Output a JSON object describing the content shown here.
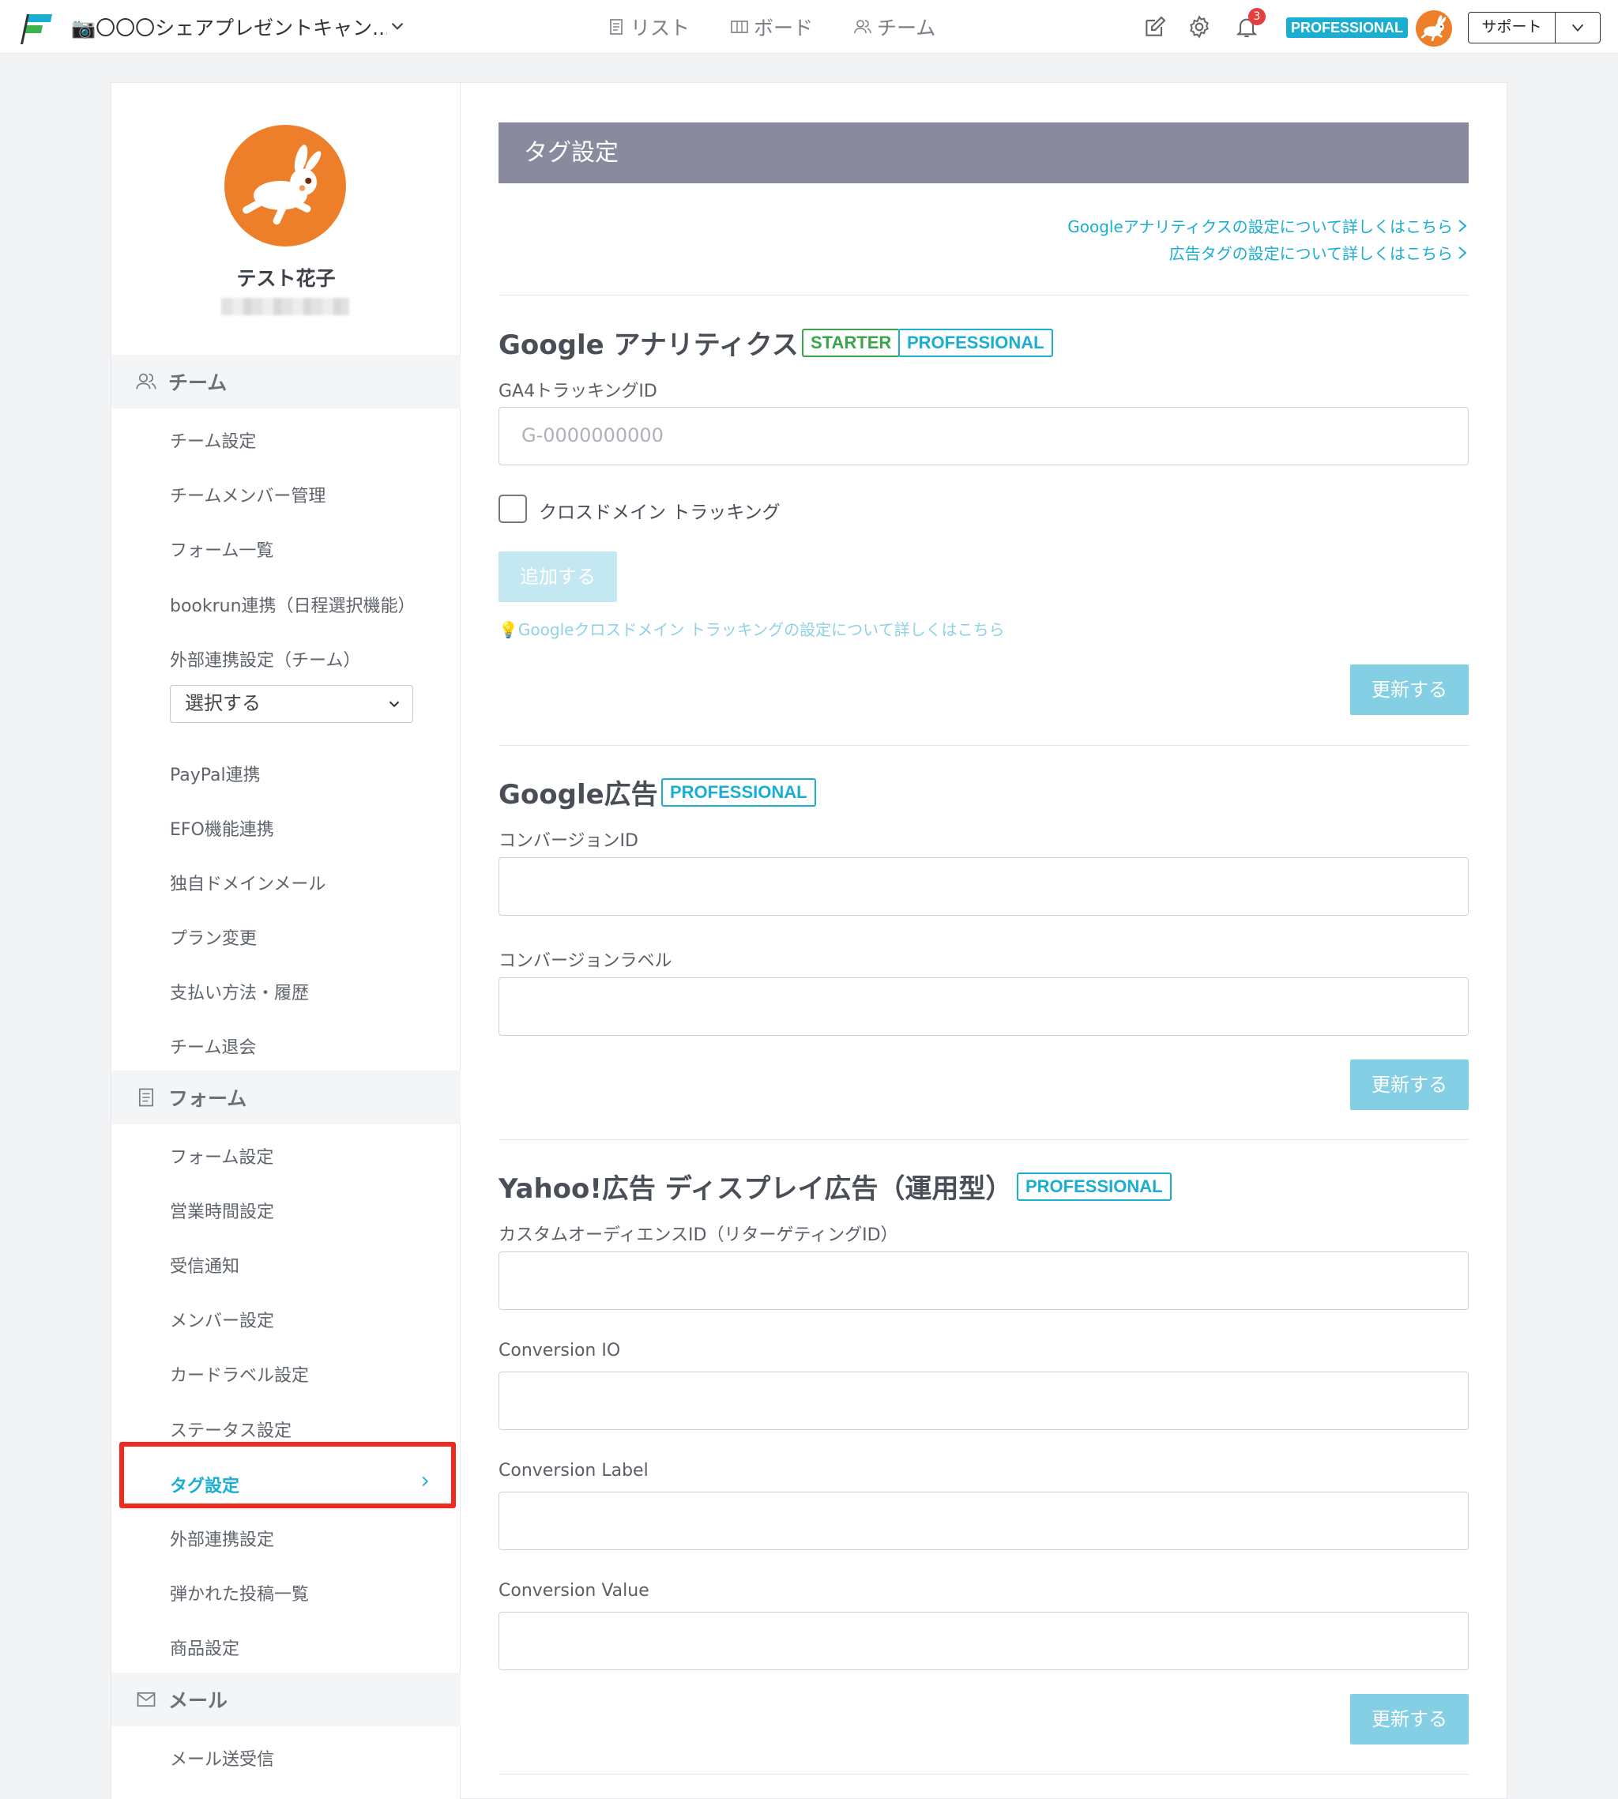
{
  "header": {
    "project_title": "📷〇〇〇シェアプレゼントキャン...",
    "nav": [
      {
        "label": "リスト",
        "icon": "list-doc-icon"
      },
      {
        "label": "ボード",
        "icon": "board-columns-icon"
      },
      {
        "label": "チーム",
        "icon": "team-people-icon"
      }
    ],
    "notification_count": "3",
    "plan_badge": "PROFESSIONAL",
    "support_label": "サポート",
    "accent_color": "#1aaed1"
  },
  "sidebar": {
    "user_name": "テスト花子",
    "sections": [
      {
        "title": "チーム",
        "icon": "team-people-icon",
        "items": [
          "チーム設定",
          "チームメンバー管理",
          "フォーム一覧",
          "bookrun連携（日程選択機能）",
          "外部連携設定（チーム）"
        ]
      },
      {
        "title": "フォーム",
        "icon": "form-doc-icon",
        "items": [
          "フォーム設定",
          "営業時間設定",
          "受信通知",
          "メンバー設定",
          "カードラベル設定",
          "ステータス設定",
          "タグ設定",
          "外部連携設定",
          "弾かれた投稿一覧",
          "商品設定"
        ]
      },
      {
        "title": "メール",
        "icon": "mail-envelope-icon",
        "items": [
          "メール送受信"
        ]
      }
    ],
    "team_select_value": "選択する",
    "team_items_after_select": [
      "PayPal連携",
      "EFO機能連携",
      "独自ドメインメール",
      "プラン変更",
      "支払い方法・履歴",
      "チーム退会"
    ],
    "active_item": "タグ設定",
    "highlight_color": "#f02a1e"
  },
  "main": {
    "page_title": "タグ設定",
    "help_links": [
      "Googleアナリティクスの設定について詳しくはこちら",
      "広告タグの設定について詳しくはこちら"
    ],
    "ga": {
      "title": "Google アナリティクス",
      "tags": [
        "STARTER",
        "PROFESSIONAL"
      ],
      "field_label": "GA4トラッキングID",
      "placeholder": "G-0000000000",
      "checkbox_label": "クロスドメイン トラッキング",
      "add_button": "追加する",
      "tip_link": "💡Googleクロスドメイン トラッキングの設定について詳しくはこちら",
      "update_button": "更新する"
    },
    "gads": {
      "title": "Google広告",
      "tag": "PROFESSIONAL",
      "field1_label": "コンバージョンID",
      "field2_label": "コンバージョンラベル",
      "update_button": "更新する"
    },
    "yahoo": {
      "title": "Yahoo!広告 ディスプレイ広告（運用型）",
      "tag": "PROFESSIONAL",
      "field1_label": "カスタムオーディエンスID（リターゲティングID）",
      "field2_label": "Conversion IO",
      "field3_label": "Conversion Label",
      "field4_label": "Conversion Value",
      "update_button": "更新する"
    }
  }
}
